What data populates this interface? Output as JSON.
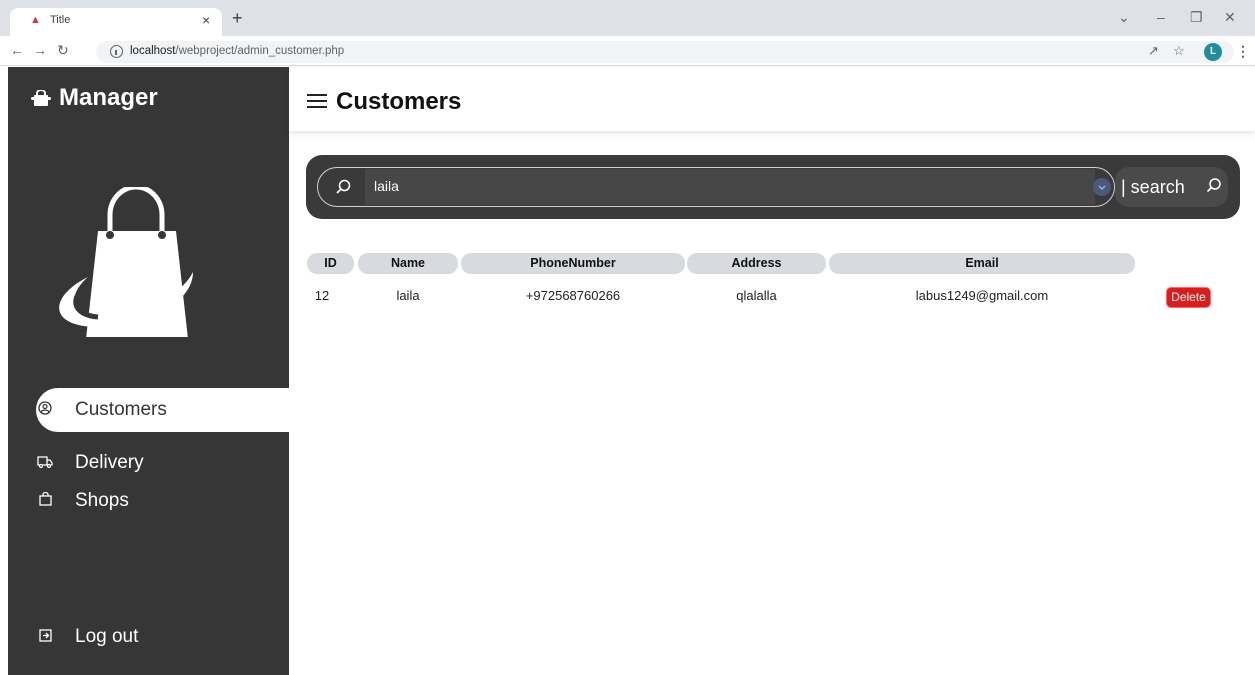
{
  "browser": {
    "tab_title": "Title",
    "tab_close": "×",
    "new_tab": "+",
    "url_host": "localhost",
    "url_path": "/webproject/admin_customer.php",
    "profile_initial": "L",
    "icons": [
      "favicon",
      "close-icon",
      "plus-icon",
      "back-icon",
      "forward-icon",
      "reload-icon",
      "info-icon",
      "share-icon",
      "star-icon",
      "profile-avatar",
      "kebab-menu-icon",
      "minimize-icon",
      "maximize-icon",
      "window-close-icon",
      "tab-search-icon"
    ]
  },
  "sidebar": {
    "brand": "Manager",
    "items": [
      {
        "label": "Customers",
        "icon": "user-circle-icon",
        "active": true
      },
      {
        "label": "Delivery",
        "icon": "truck-icon",
        "active": false
      },
      {
        "label": "Shops",
        "icon": "bag-icon",
        "active": false
      }
    ],
    "logout": {
      "label": "Log out",
      "icon": "logout-icon"
    }
  },
  "header": {
    "title": "Customers"
  },
  "search": {
    "value": "laila",
    "button_label": "| search"
  },
  "table": {
    "columns": [
      "ID",
      "Name",
      "PhoneNumber",
      "Address",
      "Email"
    ],
    "rows": [
      {
        "id": "12",
        "name": "laila",
        "phone": "+972568760266",
        "address": "qlalalla",
        "email": "labus1249@gmail.com",
        "action": "Delete"
      }
    ]
  },
  "colors": {
    "sidebar_bg": "#363636",
    "search_panel_bg": "#3a3a3a",
    "header_cell_bg": "#d7dbe0",
    "delete_red": "#dc1b1b"
  }
}
